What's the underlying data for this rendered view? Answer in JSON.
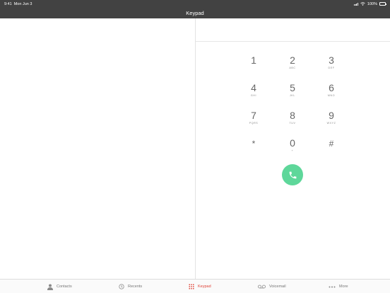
{
  "status": {
    "time": "9:41",
    "date": "Mon Jun 3",
    "battery": "100%"
  },
  "nav": {
    "title": "Keypad"
  },
  "keypad": {
    "keys": [
      {
        "digit": "1",
        "letters": ""
      },
      {
        "digit": "2",
        "letters": "ABC"
      },
      {
        "digit": "3",
        "letters": "DEF"
      },
      {
        "digit": "4",
        "letters": "GHI"
      },
      {
        "digit": "5",
        "letters": "JKL"
      },
      {
        "digit": "6",
        "letters": "MNO"
      },
      {
        "digit": "7",
        "letters": "PQRS"
      },
      {
        "digit": "8",
        "letters": "TUV"
      },
      {
        "digit": "9",
        "letters": "WXYZ"
      },
      {
        "digit": "*",
        "letters": ""
      },
      {
        "digit": "0",
        "letters": "+"
      },
      {
        "digit": "#",
        "letters": ""
      }
    ],
    "call_icon": "phone-icon",
    "call_color": "#5ed79a"
  },
  "tabs": [
    {
      "label": "Contacts",
      "icon": "person-icon",
      "active": false
    },
    {
      "label": "Recents",
      "icon": "clock-icon",
      "active": false
    },
    {
      "label": "Keypad",
      "icon": "keypad-icon",
      "active": true
    },
    {
      "label": "Voicemail",
      "icon": "voicemail-icon",
      "active": false
    },
    {
      "label": "More",
      "icon": "more-icon",
      "active": false
    }
  ],
  "colors": {
    "bar_background": "#424242",
    "active_tab": "#e0453a"
  }
}
